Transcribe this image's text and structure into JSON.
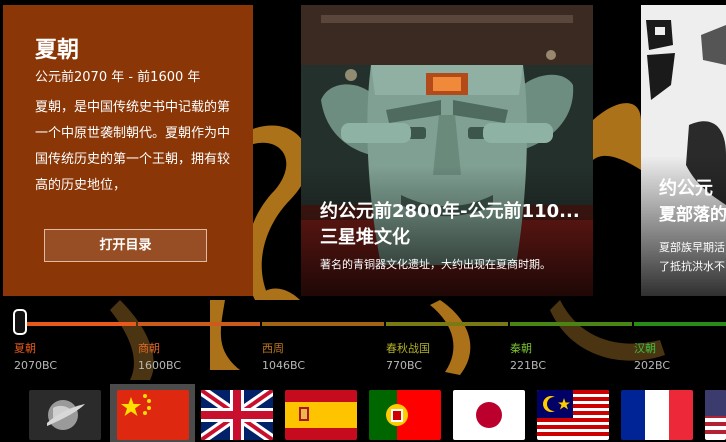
{
  "intro": {
    "title": "夏朝",
    "period": "公元前2070 年 - 前1600 年",
    "description": "夏朝，是中国传统史书中记载的第一个中原世袭制朝代。夏朝作为中国传统历史的第一个王朝，拥有较高的历史地位，",
    "button_label": "打开目录"
  },
  "main_card": {
    "date": "约公元前2800年-公元前110...",
    "culture": "三星堆文化",
    "caption": "著名的青铜器文化遗址，大约出现在夏商时期。"
  },
  "side_card": {
    "date": "约公元",
    "culture": "夏部落的",
    "caption_line1": "夏部族早期活",
    "caption_line2": "了抵抗洪水不"
  },
  "timeline": {
    "periods": [
      {
        "name": "夏朝",
        "year": "2070BC",
        "color": "#e85a1c"
      },
      {
        "name": "商朝",
        "year": "1600BC",
        "color": "#e06a2a"
      },
      {
        "name": "西周",
        "year": "1046BC",
        "color": "#c07a22"
      },
      {
        "name": "春秋战国",
        "year": "770BC",
        "color": "#b2b02a"
      },
      {
        "name": "秦朝",
        "year": "221BC",
        "color": "#7cc232"
      },
      {
        "name": "汉朝",
        "year": "202BC",
        "color": "#3cc040"
      }
    ],
    "selected_index": 0
  },
  "languages": {
    "items": [
      "globe",
      "china",
      "united-kingdom",
      "spain",
      "portugal",
      "japan",
      "malaysia",
      "france",
      "usa"
    ],
    "selected": "china"
  },
  "colors": {
    "intro_bg": "#8a3606",
    "accent": "#e85a1c"
  }
}
